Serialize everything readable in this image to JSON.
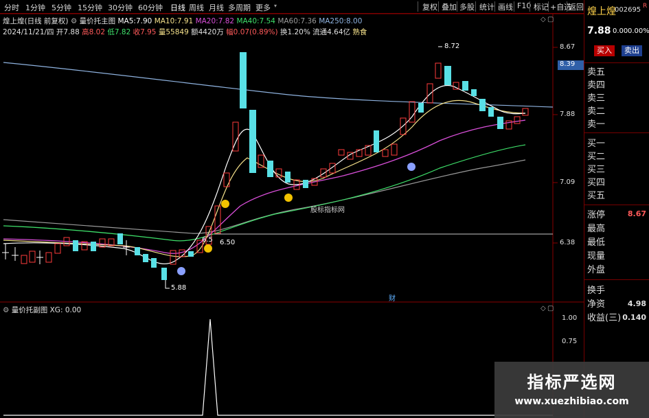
{
  "toolbar": {
    "periods": [
      "分时",
      "1分钟",
      "5分钟",
      "15分钟",
      "30分钟",
      "60分钟",
      "日线",
      "周线",
      "月线",
      "多周期",
      "更多"
    ],
    "active_period": "日线",
    "buttons": [
      "复权",
      "叠加",
      "多股",
      "统计",
      "画线",
      "F10",
      "标记",
      "+自选",
      "返回"
    ]
  },
  "stock": {
    "name": "煌上煌",
    "code": "002695",
    "r_mark": "R",
    "price": "7.88",
    "change": "0.00",
    "change_pct": "0.00%"
  },
  "chart_header": {
    "name_label": "煌上煌(日线 前复权)",
    "indicator_name": "量价托主图",
    "ma": [
      {
        "label": "MA5:",
        "value": "7.90",
        "color": "#ffffff"
      },
      {
        "label": "MA10:",
        "value": "7.91",
        "color": "#f4e08a"
      },
      {
        "label": "MA20:",
        "value": "7.82",
        "color": "#d94fd9"
      },
      {
        "label": "MA40:",
        "value": "7.54",
        "color": "#3ee06a"
      },
      {
        "label": "MA60:",
        "value": "7.36",
        "color": "#9a9a9a"
      },
      {
        "label": "MA250:",
        "value": "8.00",
        "color": "#8fb3e0"
      }
    ]
  },
  "day_info": {
    "date": "2024/11/21/四",
    "open": {
      "label": "开",
      "value": "7.88"
    },
    "high": {
      "label": "高",
      "value": "8.02"
    },
    "low": {
      "label": "低",
      "value": "7.82"
    },
    "close": {
      "label": "收",
      "value": "7.95"
    },
    "volume": {
      "label": "量",
      "value": "55849"
    },
    "amount": {
      "label": "额",
      "value": "4420万"
    },
    "amplitude": {
      "label": "幅",
      "value": "0.07(0.89%)"
    },
    "turnover": {
      "label": "换",
      "value": "1.20%"
    },
    "float": {
      "label": "流通",
      "value": "4.64亿"
    },
    "tag": "熟食"
  },
  "price_axis": {
    "ticks": [
      "8.67",
      "7.88",
      "7.09",
      "6.38"
    ],
    "current_tag": "8.39"
  },
  "annotations": {
    "high_label": "8.72",
    "low_label": "5.88",
    "mid_label": "6.50",
    "mid_label2": "6.5",
    "watermark_text": "股标指标网",
    "cai_label": "财"
  },
  "sub_chart": {
    "title": "量价托副图",
    "xg_label": "XG:",
    "xg_value": "0.00",
    "axis_ticks": [
      "1.00",
      "0.75"
    ]
  },
  "right_panel": {
    "buy_label": "买入",
    "sell_label": "卖出",
    "sell_rows": [
      "卖五",
      "卖四",
      "卖三",
      "卖二",
      "卖一"
    ],
    "buy_rows": [
      "买一",
      "买二",
      "买三",
      "买四",
      "买五"
    ],
    "stats": [
      {
        "label": "涨停",
        "value": "8.67",
        "color": "#ff5a5a"
      },
      {
        "label": "最高",
        "value": "",
        "color": "#dcdcdc"
      },
      {
        "label": "最低",
        "value": "",
        "color": "#dcdcdc"
      },
      {
        "label": "现量",
        "value": "",
        "color": "#dcdcdc"
      },
      {
        "label": "外盘",
        "value": "",
        "color": "#dcdcdc"
      },
      {
        "label": "换手",
        "value": "",
        "color": "#dcdcdc"
      },
      {
        "label": "净资",
        "value": "4.98",
        "color": "#dcdcdc"
      },
      {
        "label": "收益(三)",
        "value": "0.140",
        "color": "#dcdcdc"
      }
    ]
  },
  "watermark": {
    "title": "指标严选网",
    "url": "www.xuezhibiao.com"
  },
  "colors": {
    "up": "#ff3b3b",
    "down": "#59e0e6",
    "axis_red": "#b00000",
    "ma5": "#ffffff",
    "ma10": "#f4e08a",
    "ma20": "#d94fd9",
    "ma40": "#3ee06a",
    "ma60": "#9a9a9a",
    "ma250": "#8fb3e0"
  }
}
